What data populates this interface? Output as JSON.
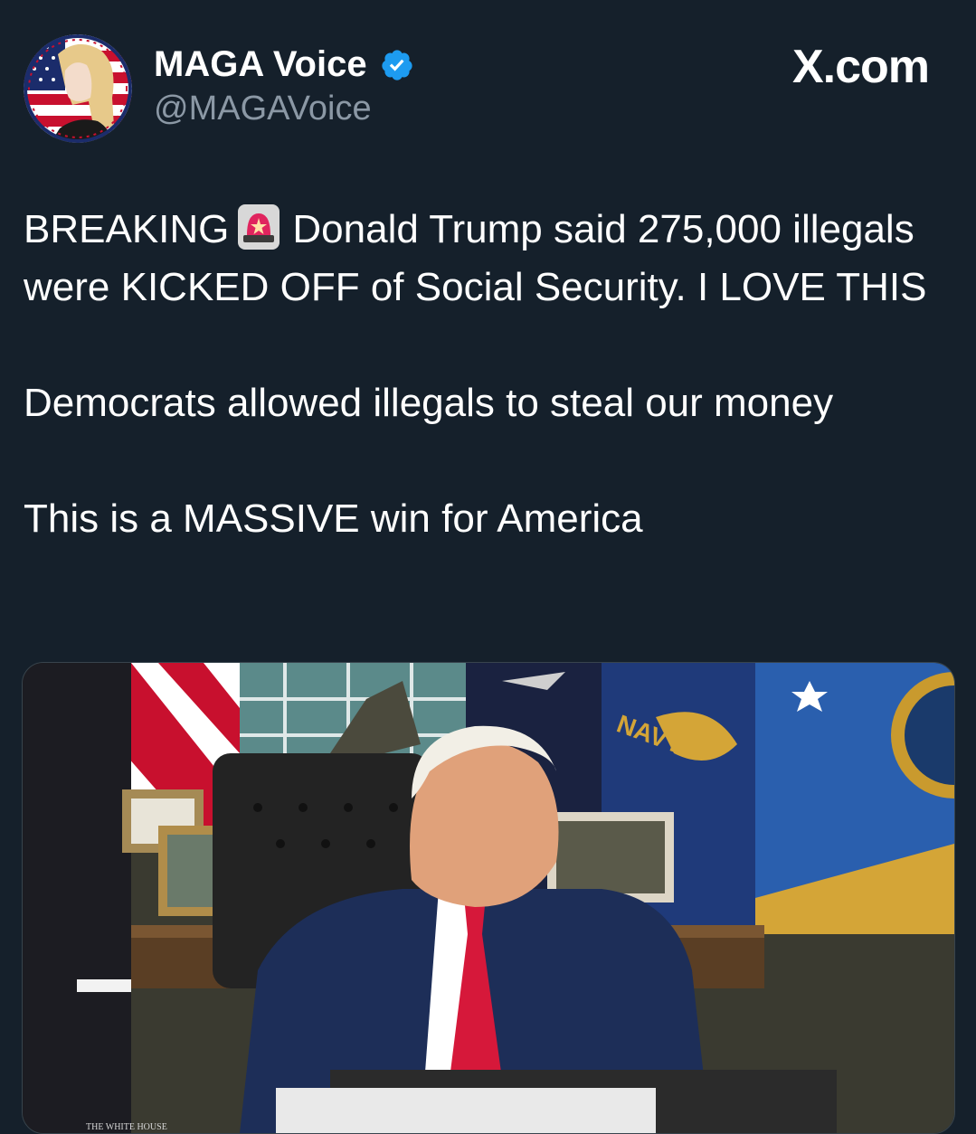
{
  "author": {
    "display_name": "MAGA Voice",
    "handle": "@MAGAVoice",
    "verified": true,
    "avatar_icon": "avatar-flag-portrait"
  },
  "brand": {
    "label": "X.com"
  },
  "tweet": {
    "lines": [
      {
        "before": "BREAKING",
        "icon": "police-light-icon",
        "after": "Donald Trump said 275,000 illegals were KICKED OFF of Social Security. I LOVE THIS"
      }
    ],
    "paragraph_2": "Democrats allowed illegals to steal our money",
    "paragraph_3": "This is a MASSIVE win for America"
  },
  "media": {
    "type": "photo",
    "description_icon": "oval-office-photo",
    "flag_text": "NAVY",
    "lower_left_text": "THE WHITE HOUSE"
  },
  "colors": {
    "background": "#15202b",
    "text": "#ffffff",
    "secondary_text": "#8b98a5",
    "verified_blue": "#1d9bf0",
    "alarm_red": "#e0245e"
  }
}
